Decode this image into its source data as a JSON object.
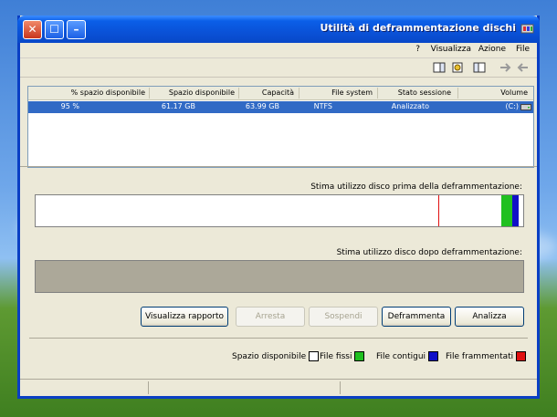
{
  "window": {
    "title": "Utilità di deframmentazione dischi"
  },
  "menu": [
    "File",
    "Azione",
    "Visualizza",
    "?"
  ],
  "list": {
    "columns": [
      "Volume",
      "Stato sessione",
      "File system",
      "Capacità",
      "Spazio disponibile",
      "% spazio disponibile"
    ],
    "rows": [
      {
        "volume": "(C:)",
        "stato": "Analizzato",
        "fs": "NTFS",
        "capacita": "63.99 GB",
        "spazio": "61.17 GB",
        "percent": "95 %"
      }
    ]
  },
  "labels": {
    "before": "Stima utilizzo disco prima della deframmentazione:",
    "after": "Stima utilizzo disco dopo deframmentazione:"
  },
  "buttons": {
    "analizza": "Analizza",
    "deframmenta": "Deframmenta",
    "sospendi": "Sospendi",
    "arresta": "Arresta",
    "rapporto": "Visualizza rapporto"
  },
  "legend": {
    "frammentati": "File frammentati",
    "contigui": "File contigui",
    "fissi": "File fissi",
    "spazio": "Spazio disponibile"
  },
  "colors": {
    "frammentati": "#e01010",
    "contigui": "#1010c8",
    "fissi": "#20c020",
    "spazio": "#ffffff"
  }
}
